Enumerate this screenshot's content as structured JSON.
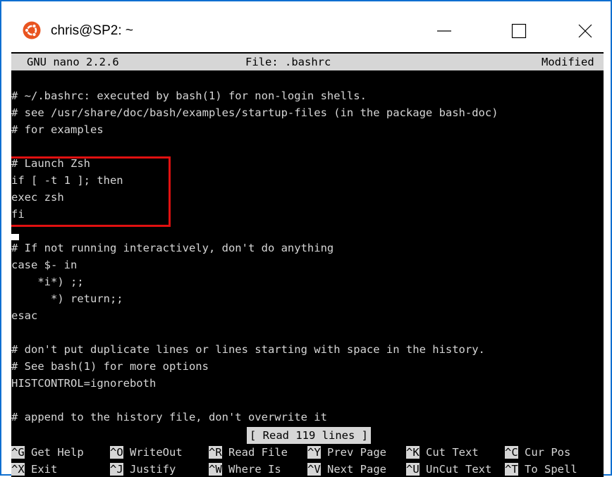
{
  "window": {
    "title": "chris@SP2: ~",
    "icon": "ubuntu-logo-icon",
    "controls": [
      "minimize-icon",
      "maximize-icon",
      "close-icon"
    ],
    "accent": "#0f6fd0"
  },
  "nano": {
    "version": "GNU nano 2.2.6",
    "file": "File: .bashrc",
    "state": "Modified"
  },
  "lines": [
    "# ~/.bashrc: executed by bash(1) for non-login shells.",
    "# see /usr/share/doc/bash/examples/startup-files (in the package bash-doc)",
    "# for examples",
    "",
    "# Launch Zsh",
    "if [ -t 1 ]; then",
    "exec zsh",
    "fi",
    "",
    "# If not running interactively, don't do anything",
    "case $- in",
    "    *i*) ;;",
    "      *) return;;",
    "esac",
    "",
    "# don't put duplicate lines or lines starting with space in the history.",
    "# See bash(1) for more options",
    "HISTCONTROL=ignoreboth",
    "",
    "# append to the history file, don't overwrite it"
  ],
  "status": "[ Read 119 lines ]",
  "shortcuts": {
    "row1": [
      {
        "key": "^G",
        "label": " Get Help"
      },
      {
        "key": "^O",
        "label": " WriteOut"
      },
      {
        "key": "^R",
        "label": " Read File"
      },
      {
        "key": "^Y",
        "label": " Prev Page"
      },
      {
        "key": "^K",
        "label": " Cut Text"
      },
      {
        "key": "^C",
        "label": " Cur Pos"
      }
    ],
    "row2": [
      {
        "key": "^X",
        "label": " Exit"
      },
      {
        "key": "^J",
        "label": " Justify"
      },
      {
        "key": "^W",
        "label": " Where Is"
      },
      {
        "key": "^V",
        "label": " Next Page"
      },
      {
        "key": "^U",
        "label": " UnCut Text"
      },
      {
        "key": "^T",
        "label": " To Spell"
      }
    ]
  },
  "colors": {
    "terminal_bg": "#000000",
    "terminal_fg": "#d6d6d6",
    "highlight_box": "#e01010"
  }
}
